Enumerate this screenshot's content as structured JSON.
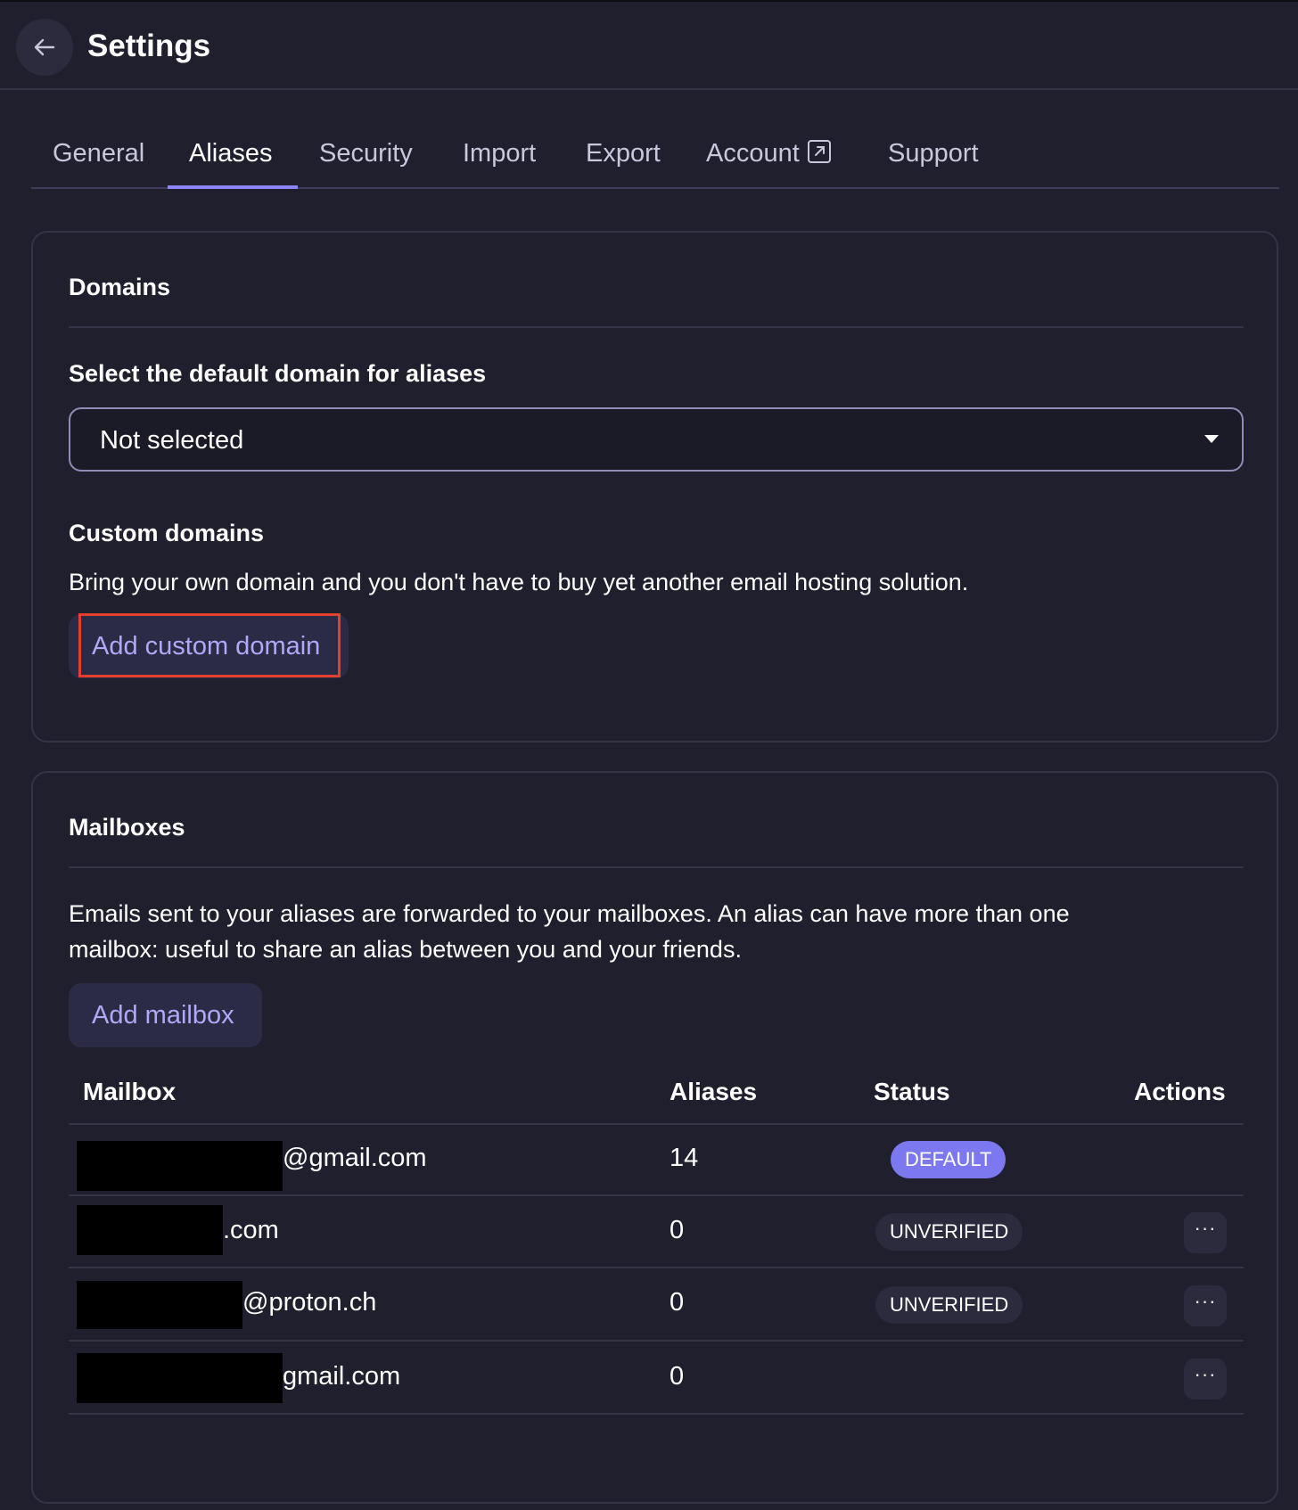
{
  "header": {
    "title": "Settings"
  },
  "tabs": [
    {
      "label": "General"
    },
    {
      "label": "Aliases",
      "active": true
    },
    {
      "label": "Security"
    },
    {
      "label": "Import"
    },
    {
      "label": "Export"
    },
    {
      "label": "Account",
      "icon": "external-link-icon"
    },
    {
      "label": "Support"
    }
  ],
  "domains": {
    "title": "Domains",
    "default_label": "Select the default domain for aliases",
    "default_value": "Not selected",
    "custom_title": "Custom domains",
    "custom_desc": "Bring your own domain and you don't have to buy yet another email hosting solution.",
    "add_button": "Add custom domain"
  },
  "mailboxes": {
    "title": "Mailboxes",
    "desc_line1": "Emails sent to your aliases are forwarded to your mailboxes. An alias can have more than one",
    "desc_line2": "mailbox: useful to share an alias between you and your friends.",
    "add_button": "Add mailbox",
    "columns": [
      "Mailbox",
      "Aliases",
      "Status",
      "Actions"
    ],
    "rows": [
      {
        "mailbox_suffix": "@gmail.com",
        "aliases": "14",
        "status": "DEFAULT",
        "actions": ""
      },
      {
        "mailbox_suffix": ".com",
        "aliases": "0",
        "status": "UNVERIFIED",
        "actions": "···"
      },
      {
        "mailbox_suffix": "@proton.ch",
        "aliases": "0",
        "status": "UNVERIFIED",
        "actions": "···"
      },
      {
        "mailbox_suffix": "gmail.com",
        "aliases": "0",
        "status": "",
        "actions": "···"
      }
    ]
  },
  "colors": {
    "background": "#1f1f2e",
    "accent": "#8c85f5",
    "badge_default": "#7b78f0",
    "highlight": "#e4402c"
  }
}
